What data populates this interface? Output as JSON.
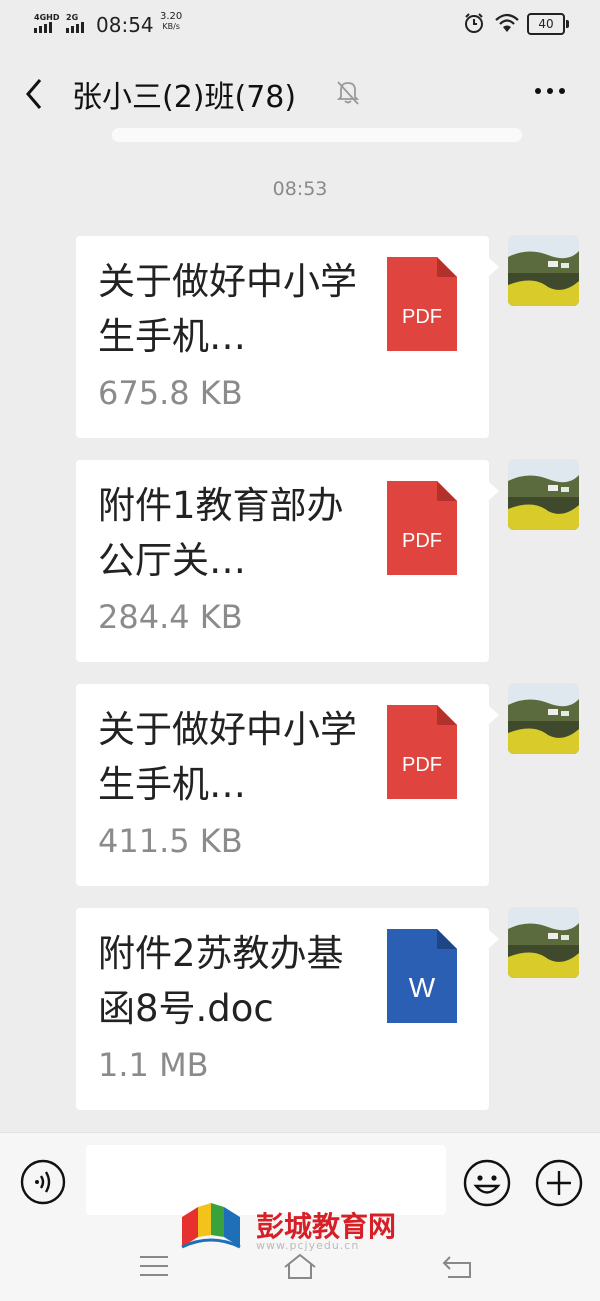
{
  "status_bar": {
    "network1": "4GHD",
    "network2": "2G",
    "time": "08:54",
    "speed_value": "3.20",
    "speed_unit": "KB/s",
    "battery": "40"
  },
  "header": {
    "title": "张小三(2)班(78)"
  },
  "timestamp": "08:53",
  "messages": [
    {
      "filename": "关于做好中小学生手机…",
      "size": "675.8 KB",
      "file_type": "PDF",
      "icon_color": "#e0443f"
    },
    {
      "filename": "附件1教育部办公厅关…",
      "size": "284.4 KB",
      "file_type": "PDF",
      "icon_color": "#e0443f"
    },
    {
      "filename": "关于做好中小学生手机…",
      "size": "411.5 KB",
      "file_type": "PDF",
      "icon_color": "#e0443f"
    },
    {
      "filename": "附件2苏教办基函8号.doc",
      "size": "1.1 MB",
      "file_type": "W",
      "icon_color": "#2b5fb4"
    }
  ],
  "watermark": {
    "text": "彭城教育网",
    "url": "www.pcjyedu.cn"
  },
  "colors": {
    "background": "#ededed",
    "bubble": "#ffffff",
    "pdf_red": "#e0443f",
    "word_blue": "#2b5fb4",
    "watermark_red": "#d61f26"
  }
}
